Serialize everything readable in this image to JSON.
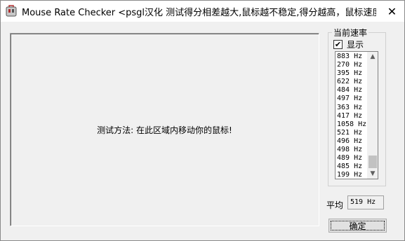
{
  "window": {
    "title": "Mouse Rate Checker <psgl汉化  测试得分相差越大,鼠标越不稳定,得分越高，鼠标速度越快>",
    "close_glyph": "✕"
  },
  "track_area": {
    "instruction": "测试方法: 在此区域内移动你的鼠标!"
  },
  "rate_panel": {
    "group_label": "当前速率",
    "show_checkbox": {
      "label": "显示",
      "checked": true
    },
    "rates": [
      "883 Hz",
      "270 Hz",
      "395 Hz",
      "622 Hz",
      "484 Hz",
      "497 Hz",
      "363 Hz",
      "417 Hz",
      "1058 Hz",
      "521 Hz",
      "496 Hz",
      "498 Hz",
      "489 Hz",
      "485 Hz",
      "199 Hz"
    ]
  },
  "average": {
    "label": "平均",
    "value": "519 Hz"
  },
  "ok_button": {
    "label": "确定"
  }
}
